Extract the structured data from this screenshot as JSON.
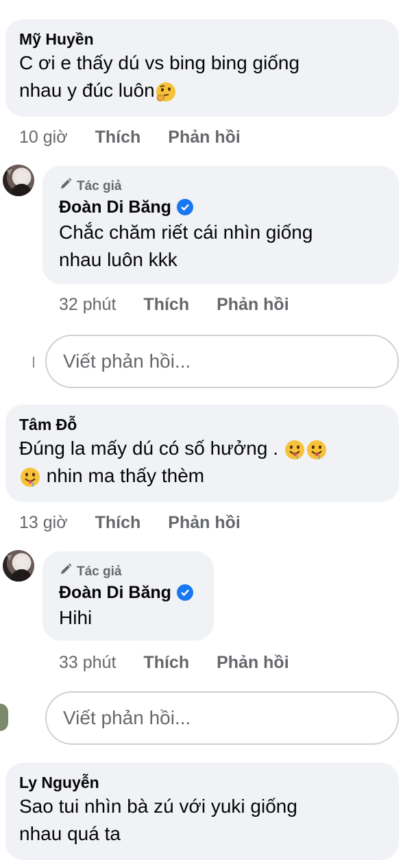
{
  "comments": [
    {
      "author": "Mỹ Huyền",
      "line1": "C ơi e thấy dú vs bing bing giống",
      "line2": "nhau y đúc luôn",
      "time": "10 giờ",
      "like": "Thích",
      "reply": "Phản hồi",
      "reply_item": {
        "author_tag": "Tác giả",
        "author": "Đoàn Di Băng",
        "line1": "Chắc chăm riết cái nhìn giống",
        "line2": "nhau luôn kkk",
        "time": "32 phút",
        "like": "Thích",
        "reply": "Phản hồi"
      },
      "reply_placeholder": "Viết phản hồi..."
    },
    {
      "author": "Tâm Đỗ",
      "line1": "Đúng la mấy dú có số hưởng .",
      "line2": "nhin ma thấy thèm",
      "time": "13 giờ",
      "like": "Thích",
      "reply": "Phản hồi",
      "reply_item": {
        "author_tag": "Tác giả",
        "author": "Đoàn Di Băng",
        "line1": "Hihi",
        "time": "33 phút",
        "like": "Thích",
        "reply": "Phản hồi"
      },
      "reply_placeholder": "Viết phản hồi..."
    },
    {
      "author": "Ly Nguyễn",
      "line1": "Sao tui nhìn bà zú với yuki giống",
      "line2": "nhau quá ta"
    }
  ],
  "icons": {
    "thinking_emoji": "thinking-face",
    "drooling_emoji": "face-savoring-food",
    "author_tag_icon": "pencil",
    "verified_icon": "verified-check"
  },
  "colors": {
    "bubble_bg": "#f0f2f5",
    "secondary_text": "#65676b",
    "verified_blue": "#1877f2",
    "input_border": "#ced0d4"
  }
}
